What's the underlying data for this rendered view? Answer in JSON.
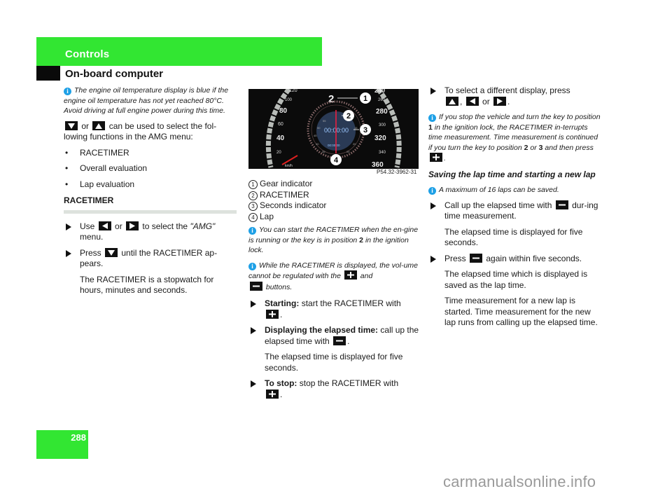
{
  "header": {
    "section": "Controls",
    "subsection": "On-board computer",
    "accent_color": "#32e632"
  },
  "page_number": "288",
  "column1": {
    "note1": "The engine oil temperature display is blue if the engine oil temperature has not yet reached 80°C. Avoid driving at full engine power during this time.",
    "menu_intro_or": "or",
    "menu_intro_text": "can be used to select the fol-lowing functions in the AMG menu:",
    "menu_items": [
      "RACETIMER",
      "Overall evaluation",
      "Lap evaluation"
    ],
    "section_heading": "RACETIMER",
    "step1_use": "Use",
    "step1_or": "or",
    "step1_text": "to select the",
    "step1_menu": "\"AMG\"",
    "step1_end": "menu.",
    "step2_press": "Press",
    "step2_text": "until the RACETIMER ap-pears.",
    "step2_sub": "The RACETIMER is a stopwatch for hours, minutes and seconds."
  },
  "column2": {
    "figure": {
      "gear": "2",
      "left_scale": [
        "120",
        "100",
        "80",
        "60",
        "40",
        "20"
      ],
      "right_scale": [
        "240",
        "260",
        "280",
        "300",
        "320",
        "340",
        "360"
      ],
      "timer": "00:00:00",
      "lap_readout": "00:00:00",
      "unit": "km/h",
      "callouts": [
        "1",
        "2",
        "3",
        "4"
      ],
      "seconds_ticks": [
        "55",
        "50",
        "45",
        "40",
        "35",
        "25",
        "20",
        "15"
      ],
      "caption": "P54.32-3962-31"
    },
    "legend": [
      {
        "num": "1",
        "label": "Gear indicator"
      },
      {
        "num": "2",
        "label": "RACETIMER"
      },
      {
        "num": "3",
        "label": "Seconds indicator"
      },
      {
        "num": "4",
        "label": "Lap"
      }
    ],
    "note1_a": "You can start the RACETIMER when the en-gine is running or the key is in position",
    "note1_bold": "2",
    "note1_b": "in the ignition lock.",
    "note2_a": "While the RACETIMER is displayed, the vol-ume cannot be regulated with the",
    "note2_and": "and",
    "note2_b": "buttons.",
    "step_start_bold": "Starting:",
    "step_start_text": "start the RACETIMER with",
    "step_elapsed_bold": "Displaying the elapsed time:",
    "step_elapsed_text": "call up the elapsed time with",
    "step_elapsed_sub": "The elapsed time is displayed for five seconds.",
    "step_stop_bold": "To stop:",
    "step_stop_text": "stop the RACETIMER with"
  },
  "column3": {
    "step1_text": "To select a different display, press",
    "step1_or": "or",
    "note1_a": "If you stop the vehicle and turn the key to position",
    "note1_b1": "1",
    "note1_b": "in the ignition lock, the RACETIMER in-terrupts time measurement. Time measurement is continued if you turn the key to position",
    "note1_b2": "2",
    "note1_or": "or",
    "note1_b3": "3",
    "note1_c": "and then press",
    "subheading": "Saving the lap time and starting a new lap",
    "note2": "A maximum of 16 laps can be saved.",
    "step2_a": "Call up the elapsed time with",
    "step2_b": "dur-ing time measurement.",
    "step2_sub": "The elapsed time is displayed for five seconds.",
    "step3_a": "Press",
    "step3_b": "again within five seconds.",
    "step3_sub1": "The elapsed time which is displayed is saved as the lap time.",
    "step3_sub2": "Time measurement for a new lap is started. Time measurement for the new lap runs from calling up the elapsed time."
  },
  "icons": {
    "info": "i",
    "key_down": "down-key",
    "key_up": "up-key",
    "key_left": "left-key",
    "key_right": "right-key",
    "key_plus": "plus-key",
    "key_minus": "minus-key"
  },
  "watermark": "carmanualsonline.info"
}
